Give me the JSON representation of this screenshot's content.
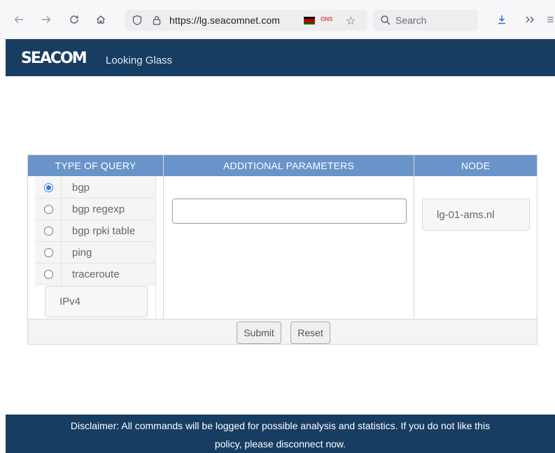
{
  "browser": {
    "url": "https://lg.seacomnet.com",
    "search_placeholder": "Search",
    "onion_label": "ONS",
    "icons": [
      "back-arrow-icon",
      "forward-arrow-icon",
      "reload-icon",
      "home-icon",
      "shield-icon",
      "lock-icon",
      "star-icon",
      "search-icon",
      "download-icon",
      "overflow-chevrons-icon",
      "menu-icon"
    ]
  },
  "header": {
    "logo": "SEACOM",
    "title": "Looking Glass"
  },
  "form": {
    "headers": {
      "query_type": "TYPE OF QUERY",
      "params": "ADDITIONAL PARAMETERS",
      "node": "NODE"
    },
    "options": [
      {
        "label": "bgp",
        "selected": true
      },
      {
        "label": "bgp regexp",
        "selected": false
      },
      {
        "label": "bgp rpki table",
        "selected": false
      },
      {
        "label": "ping",
        "selected": false
      },
      {
        "label": "traceroute",
        "selected": false
      }
    ],
    "ip_version": "IPv4",
    "param_value": "",
    "node": "lg-01-ams.nl",
    "submit_label": "Submit",
    "reset_label": "Reset"
  },
  "disclaimer": {
    "line1": "Disclaimer: All commands will be logged for possible analysis and statistics. If you do not like this",
    "line2": "policy, please disconnect now."
  },
  "colors": {
    "header_bg": "#173d63",
    "table_header": "#6a93c9",
    "radio_accent": "#3b78d8"
  }
}
